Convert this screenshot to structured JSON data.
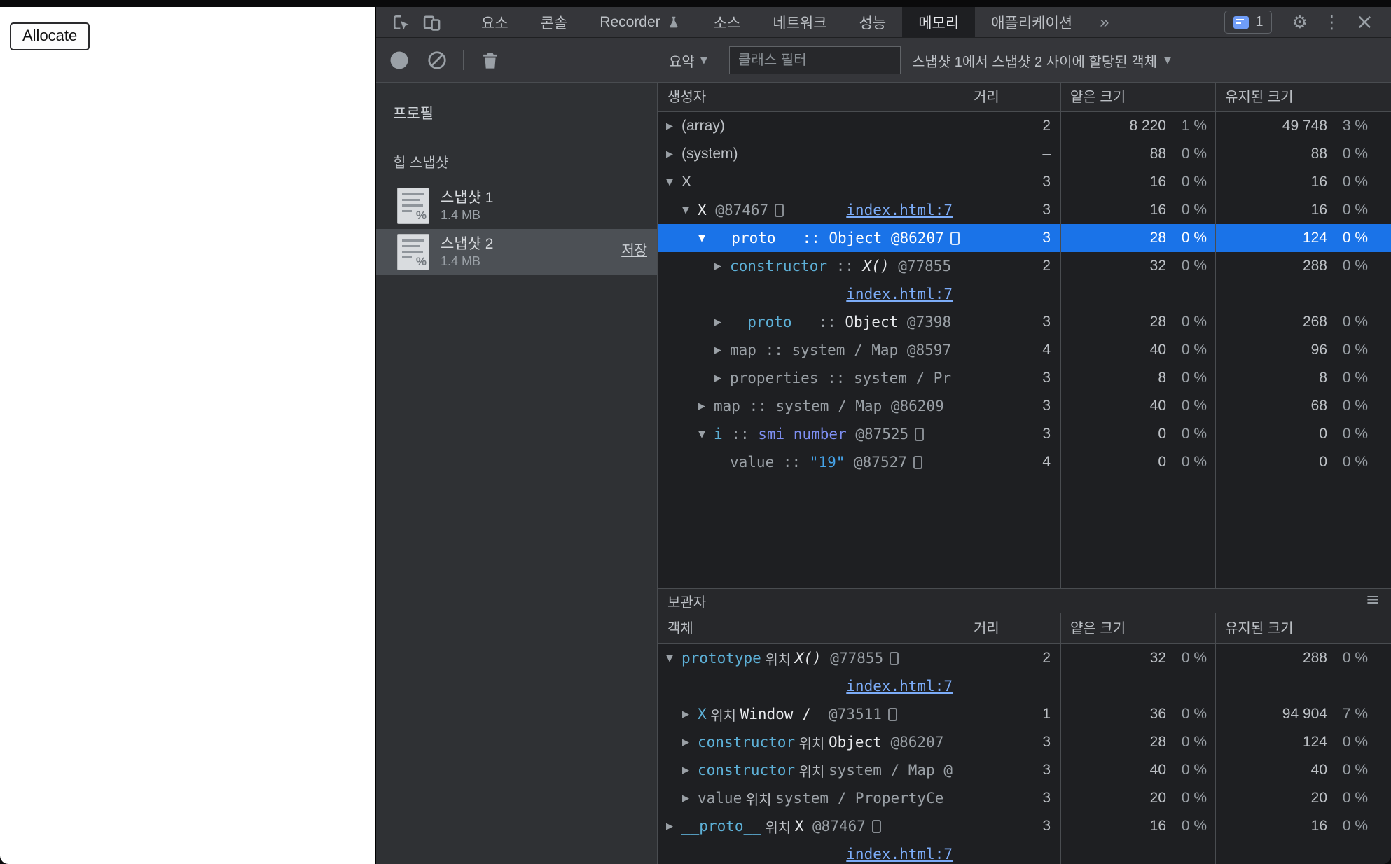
{
  "colors": {
    "sel": "#1a73e8",
    "link": "#7cacf8",
    "prop": "#5db0d7",
    "smi": "#7e8ff2",
    "str": "#45a4ea",
    "text": "#bdc1c6",
    "dim": "#9aa0a6",
    "bright": "#e8eaed",
    "bgdark": "#1e1f22",
    "bgpanel": "#35363a",
    "bgsidebar": "#2f3134",
    "bgheader": "#27282b",
    "border": "#494c50",
    "badge": "#6f9df8"
  },
  "page": {
    "allocate_button": "Allocate"
  },
  "devtools": {
    "tabbar": {
      "tabs": [
        {
          "label": "요소"
        },
        {
          "label": "콘솔"
        },
        {
          "label": "Recorder",
          "flask": true
        },
        {
          "label": "소스"
        },
        {
          "label": "네트워크"
        },
        {
          "label": "성능"
        },
        {
          "label": "메모리",
          "active": true
        },
        {
          "label": "애플리케이션"
        }
      ],
      "more_symbol": "»",
      "issues_count": "1",
      "gear_icon": "⚙",
      "kebab_icon": "⋮",
      "close_icon": "×"
    },
    "toolbar": {
      "summary_label": "요약",
      "filter_placeholder": "클래스 필터",
      "range_label": "스냅샷 1에서 스냅샷 2 사이에 할당된 객체",
      "dropdown_arrow": "▼"
    },
    "sidebar": {
      "title": "프로필",
      "section_label": "힙 스냅샷",
      "snapshots": [
        {
          "name": "스냅샷 1",
          "size": "1.4 MB",
          "selected": false,
          "save_label": ""
        },
        {
          "name": "스냅샷 2",
          "size": "1.4 MB",
          "selected": true,
          "save_label": "저장"
        }
      ]
    },
    "heap_table": {
      "columns": [
        "생성자",
        "거리",
        "얕은 크기",
        "유지된 크기"
      ],
      "rows": [
        {
          "lvl": 0,
          "ar": "r",
          "mono": false,
          "seg": [
            [
              "(array)",
              "name"
            ]
          ],
          "d": "2",
          "s": "8 220",
          "sp": "1 %",
          "rt": "49 748",
          "rp": "3 %"
        },
        {
          "lvl": 0,
          "ar": "r",
          "mono": false,
          "seg": [
            [
              "(system)",
              "name"
            ]
          ],
          "d": "–",
          "s": "88",
          "sp": "0 %",
          "rt": "88",
          "rp": "0 %"
        },
        {
          "lvl": 0,
          "ar": "v",
          "mono": false,
          "seg": [
            [
              "X",
              "name"
            ]
          ],
          "d": "3",
          "s": "16",
          "sp": "0 %",
          "rt": "16",
          "rp": "0 %"
        },
        {
          "lvl": 1,
          "ar": "v",
          "mono": true,
          "seg": [
            [
              "X",
              "val"
            ],
            [
              " @87467",
              "dim"
            ]
          ],
          "box": true,
          "ilink": "index.html:7",
          "d": "3",
          "s": "16",
          "sp": "0 %",
          "rt": "16",
          "rp": "0 %"
        },
        {
          "lvl": 2,
          "ar": "v",
          "mono": true,
          "sel": true,
          "seg": [
            [
              "__proto__",
              "prop"
            ],
            [
              " :: ",
              "dim"
            ],
            [
              "Object",
              "val"
            ],
            [
              " @86207",
              "dim"
            ]
          ],
          "box": true,
          "d": "3",
          "s": "28",
          "sp": "0 %",
          "rt": "124",
          "rp": "0 %"
        },
        {
          "lvl": 3,
          "ar": "r",
          "mono": true,
          "seg": [
            [
              "constructor",
              "prop"
            ],
            [
              " :: ",
              "dim"
            ],
            [
              "X()",
              "it"
            ],
            [
              " @77855",
              "dim"
            ]
          ],
          "link2": "index.html:7",
          "d": "2",
          "s": "32",
          "sp": "0 %",
          "rt": "288",
          "rp": "0 %"
        },
        {
          "lvl": 3,
          "ar": "r",
          "mono": true,
          "seg": [
            [
              "__proto__",
              "prop"
            ],
            [
              " :: ",
              "dim"
            ],
            [
              "Object",
              "val"
            ],
            [
              " @7398",
              "dim"
            ]
          ],
          "d": "3",
          "s": "28",
          "sp": "0 %",
          "rt": "268",
          "rp": "0 %"
        },
        {
          "lvl": 3,
          "ar": "r",
          "mono": true,
          "seg": [
            [
              "map :: system / Map @8597",
              "dim"
            ]
          ],
          "d": "4",
          "s": "40",
          "sp": "0 %",
          "rt": "96",
          "rp": "0 %"
        },
        {
          "lvl": 3,
          "ar": "r",
          "mono": true,
          "seg": [
            [
              "properties :: system / Pr",
              "dim"
            ]
          ],
          "d": "3",
          "s": "8",
          "sp": "0 %",
          "rt": "8",
          "rp": "0 %"
        },
        {
          "lvl": 2,
          "ar": "r",
          "mono": true,
          "seg": [
            [
              "map :: system / Map @86209",
              "dim"
            ]
          ],
          "d": "3",
          "s": "40",
          "sp": "0 %",
          "rt": "68",
          "rp": "0 %"
        },
        {
          "lvl": 2,
          "ar": "v",
          "mono": true,
          "seg": [
            [
              "i",
              "prop"
            ],
            [
              " :: ",
              "dim"
            ],
            [
              "smi number",
              "smi"
            ],
            [
              " @87525",
              "dim"
            ]
          ],
          "box": true,
          "d": "3",
          "s": "0",
          "sp": "0 %",
          "rt": "0",
          "rp": "0 %"
        },
        {
          "lvl": 3,
          "ar": "",
          "mono": true,
          "seg": [
            [
              "value :: ",
              "dim"
            ],
            [
              "\"19\"",
              "str"
            ],
            [
              " @87527",
              "dim"
            ]
          ],
          "box": true,
          "d": "4",
          "s": "0",
          "sp": "0 %",
          "rt": "0",
          "rp": "0 %"
        }
      ]
    },
    "retainers": {
      "title": "보관자",
      "menu_icon": "≡",
      "columns": [
        "객체",
        "거리",
        "얕은 크기",
        "유지된 크기"
      ],
      "rows": [
        {
          "lvl": 0,
          "ar": "v",
          "mono": true,
          "seg": [
            [
              "prototype",
              "prop"
            ],
            [
              " 위치 ",
              "kor"
            ],
            [
              "X()",
              "it"
            ],
            [
              " @77855",
              "dim"
            ]
          ],
          "box": true,
          "link2": "index.html:7",
          "d": "2",
          "s": "32",
          "sp": "0 %",
          "rt": "288",
          "rp": "0 %"
        },
        {
          "lvl": 1,
          "ar": "r",
          "mono": true,
          "seg": [
            [
              "X",
              "prop"
            ],
            [
              " 위치 ",
              "kor"
            ],
            [
              "Window /",
              "val"
            ],
            [
              "  @73511",
              "dim"
            ]
          ],
          "box": true,
          "d": "1",
          "s": "36",
          "sp": "0 %",
          "rt": "94 904",
          "rp": "7 %"
        },
        {
          "lvl": 1,
          "ar": "r",
          "mono": true,
          "seg": [
            [
              "constructor",
              "prop"
            ],
            [
              " 위치 ",
              "kor"
            ],
            [
              "Object",
              "val"
            ],
            [
              " @86207",
              "dim"
            ]
          ],
          "d": "3",
          "s": "28",
          "sp": "0 %",
          "rt": "124",
          "rp": "0 %"
        },
        {
          "lvl": 1,
          "ar": "r",
          "mono": true,
          "seg": [
            [
              "constructor",
              "prop"
            ],
            [
              " 위치 ",
              "kor"
            ],
            [
              "system / Map @",
              "dim"
            ]
          ],
          "d": "3",
          "s": "40",
          "sp": "0 %",
          "rt": "40",
          "rp": "0 %"
        },
        {
          "lvl": 1,
          "ar": "r",
          "mono": true,
          "seg": [
            [
              "value",
              "dim"
            ],
            [
              " 위치 ",
              "kor"
            ],
            [
              "system / PropertyCe",
              "dim"
            ]
          ],
          "d": "3",
          "s": "20",
          "sp": "0 %",
          "rt": "20",
          "rp": "0 %"
        },
        {
          "lvl": 0,
          "ar": "r",
          "mono": true,
          "seg": [
            [
              "__proto__",
              "prop"
            ],
            [
              " 위치 ",
              "kor"
            ],
            [
              "X",
              "val"
            ],
            [
              " @87467",
              "dim"
            ]
          ],
          "box": true,
          "link2": "index.html:7",
          "d": "3",
          "s": "16",
          "sp": "0 %",
          "rt": "16",
          "rp": "0 %"
        }
      ]
    }
  }
}
